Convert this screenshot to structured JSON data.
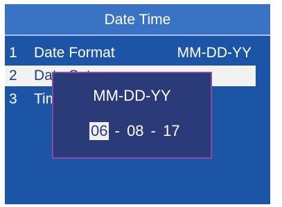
{
  "header": {
    "title": "Date Time"
  },
  "menu": {
    "items": [
      {
        "number": "1",
        "label": "Date Format",
        "value": "MM-DD-YY"
      },
      {
        "number": "2",
        "label": "Date Set",
        "value": ""
      },
      {
        "number": "3",
        "label": "Time Set",
        "value": ""
      }
    ],
    "selected_index": 2
  },
  "dialog": {
    "title": "MM-DD-YY",
    "month": "06",
    "day": "08",
    "year": "17",
    "separator": "-",
    "active_field": "month"
  },
  "colors": {
    "screen_bg": "#1d55a6",
    "titlebar_bg": "#3a73c4",
    "dialog_bg": "#2b3a78",
    "dialog_border": "#8c4aa5",
    "selection_bg": "#f2f2f2",
    "text": "#ffffff"
  }
}
